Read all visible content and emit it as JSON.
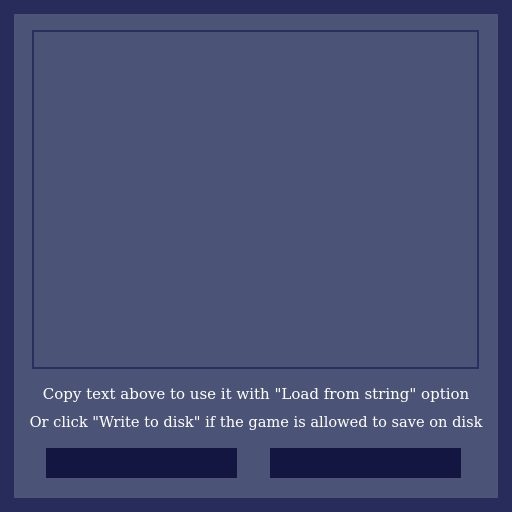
{
  "export_dialog": {
    "text_value": "",
    "line1": "Copy text above to use it with \"Load from string\" option",
    "line2": "Or click \"Write to disk\" if the game is allowed to save on disk",
    "left_button_label": "",
    "right_button_label": ""
  },
  "colors": {
    "background": "#272c5b",
    "panel": "#4b5376",
    "border": "#2a305d",
    "button": "#121641",
    "text": "#ffffff"
  }
}
